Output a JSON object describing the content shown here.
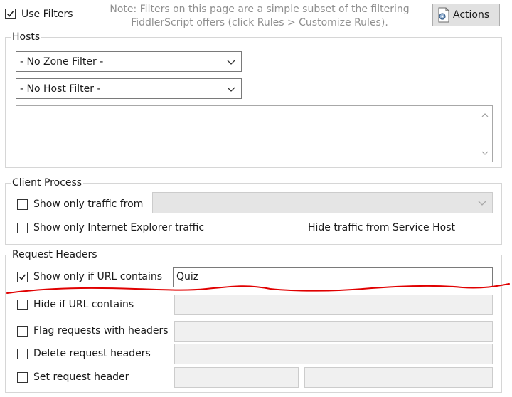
{
  "top": {
    "use_filters_label": "Use Filters",
    "use_filters_checked": true,
    "note_line1": "Note: Filters on this page are a simple subset of the filtering",
    "note_line2": "FiddlerScript offers (click Rules > Customize Rules).",
    "actions_label": "Actions"
  },
  "hosts": {
    "legend": "Hosts",
    "zone_filter": "- No Zone Filter -",
    "host_filter": "- No Host Filter -",
    "hosts_text": ""
  },
  "client_process": {
    "legend": "Client Process",
    "show_only_traffic_from_label": "Show only traffic from",
    "process_value": "",
    "show_only_ie_label": "Show only Internet Explorer traffic",
    "hide_service_host_label": "Hide traffic from Service Host"
  },
  "request_headers": {
    "legend": "Request Headers",
    "show_only_url_label": "Show only if URL contains",
    "show_only_url_checked": true,
    "show_only_url_value": "Quiz",
    "hide_url_label": "Hide if URL contains",
    "hide_url_value": "",
    "flag_headers_label": "Flag requests with headers",
    "flag_headers_value": "",
    "delete_headers_label": "Delete request headers",
    "delete_headers_value": "",
    "set_header_label": "Set request header",
    "set_header_name": "",
    "set_header_value": ""
  },
  "colors": {
    "annotation": "#e00000",
    "disabled_field": "#e5e5e5",
    "button_face": "#e1e1e1"
  }
}
